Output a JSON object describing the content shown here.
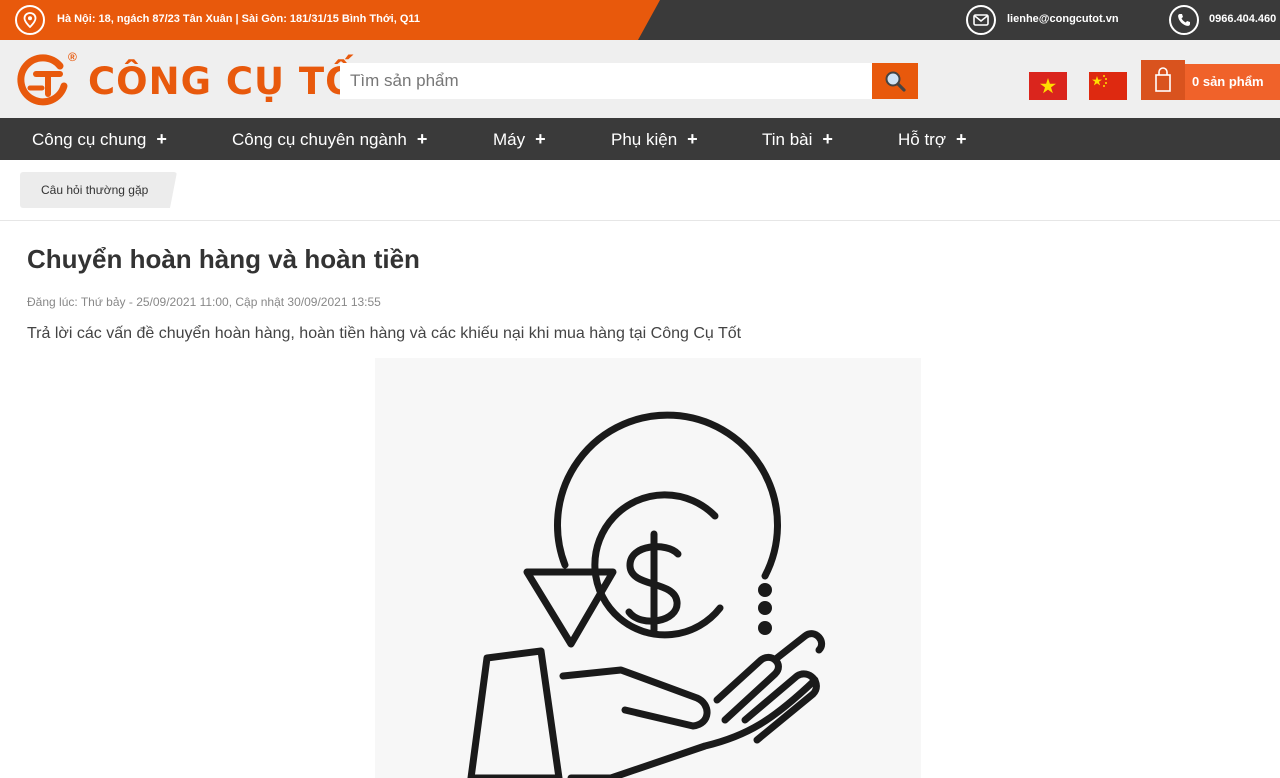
{
  "topbar": {
    "address": "Hà Nội: 18, ngách 87/23 Tân Xuân | Sài Gòn: 181/31/15 Bình Thới, Q11",
    "email": "lienhe@congcutot.vn",
    "phone": "0966.404.460",
    "icons": {
      "location": "map-pin-icon",
      "email": "envelope-icon",
      "phone": "phone-icon"
    }
  },
  "header": {
    "brand": "CÔNG CỤ TỐT",
    "registered_mark": "®",
    "search": {
      "placeholder": "Tìm sản phẩm",
      "value": ""
    },
    "cart": {
      "label": "0 sản phẩm"
    },
    "flags": [
      "vietnam-flag-icon",
      "china-flag-icon"
    ],
    "colors": {
      "brand": "#e8590c",
      "dark": "#3a3a3a"
    }
  },
  "nav": {
    "items": [
      {
        "label": "Công cụ chung",
        "plus": "+"
      },
      {
        "label": "Công cụ chuyên ngành",
        "plus": "+"
      },
      {
        "label": "Máy",
        "plus": "+"
      },
      {
        "label": "Phụ kiện",
        "plus": "+"
      },
      {
        "label": "Tin bài",
        "plus": "+"
      },
      {
        "label": "Hỗ trợ",
        "plus": "+"
      }
    ]
  },
  "breadcrumb": {
    "label": "Câu hỏi thường gặp"
  },
  "article": {
    "title": "Chuyển hoàn hàng và hoàn tiền",
    "meta": "Đăng lúc: Thứ bảy - 25/09/2021 11:00, Cập nhật 30/09/2021 13:55",
    "summary": "Trả lời các vấn đề chuyển hoàn hàng, hoàn tiền hàng và các khiếu nại khi mua hàng tại Công Cụ Tốt",
    "image_icon": "refund-money-hand-icon"
  }
}
